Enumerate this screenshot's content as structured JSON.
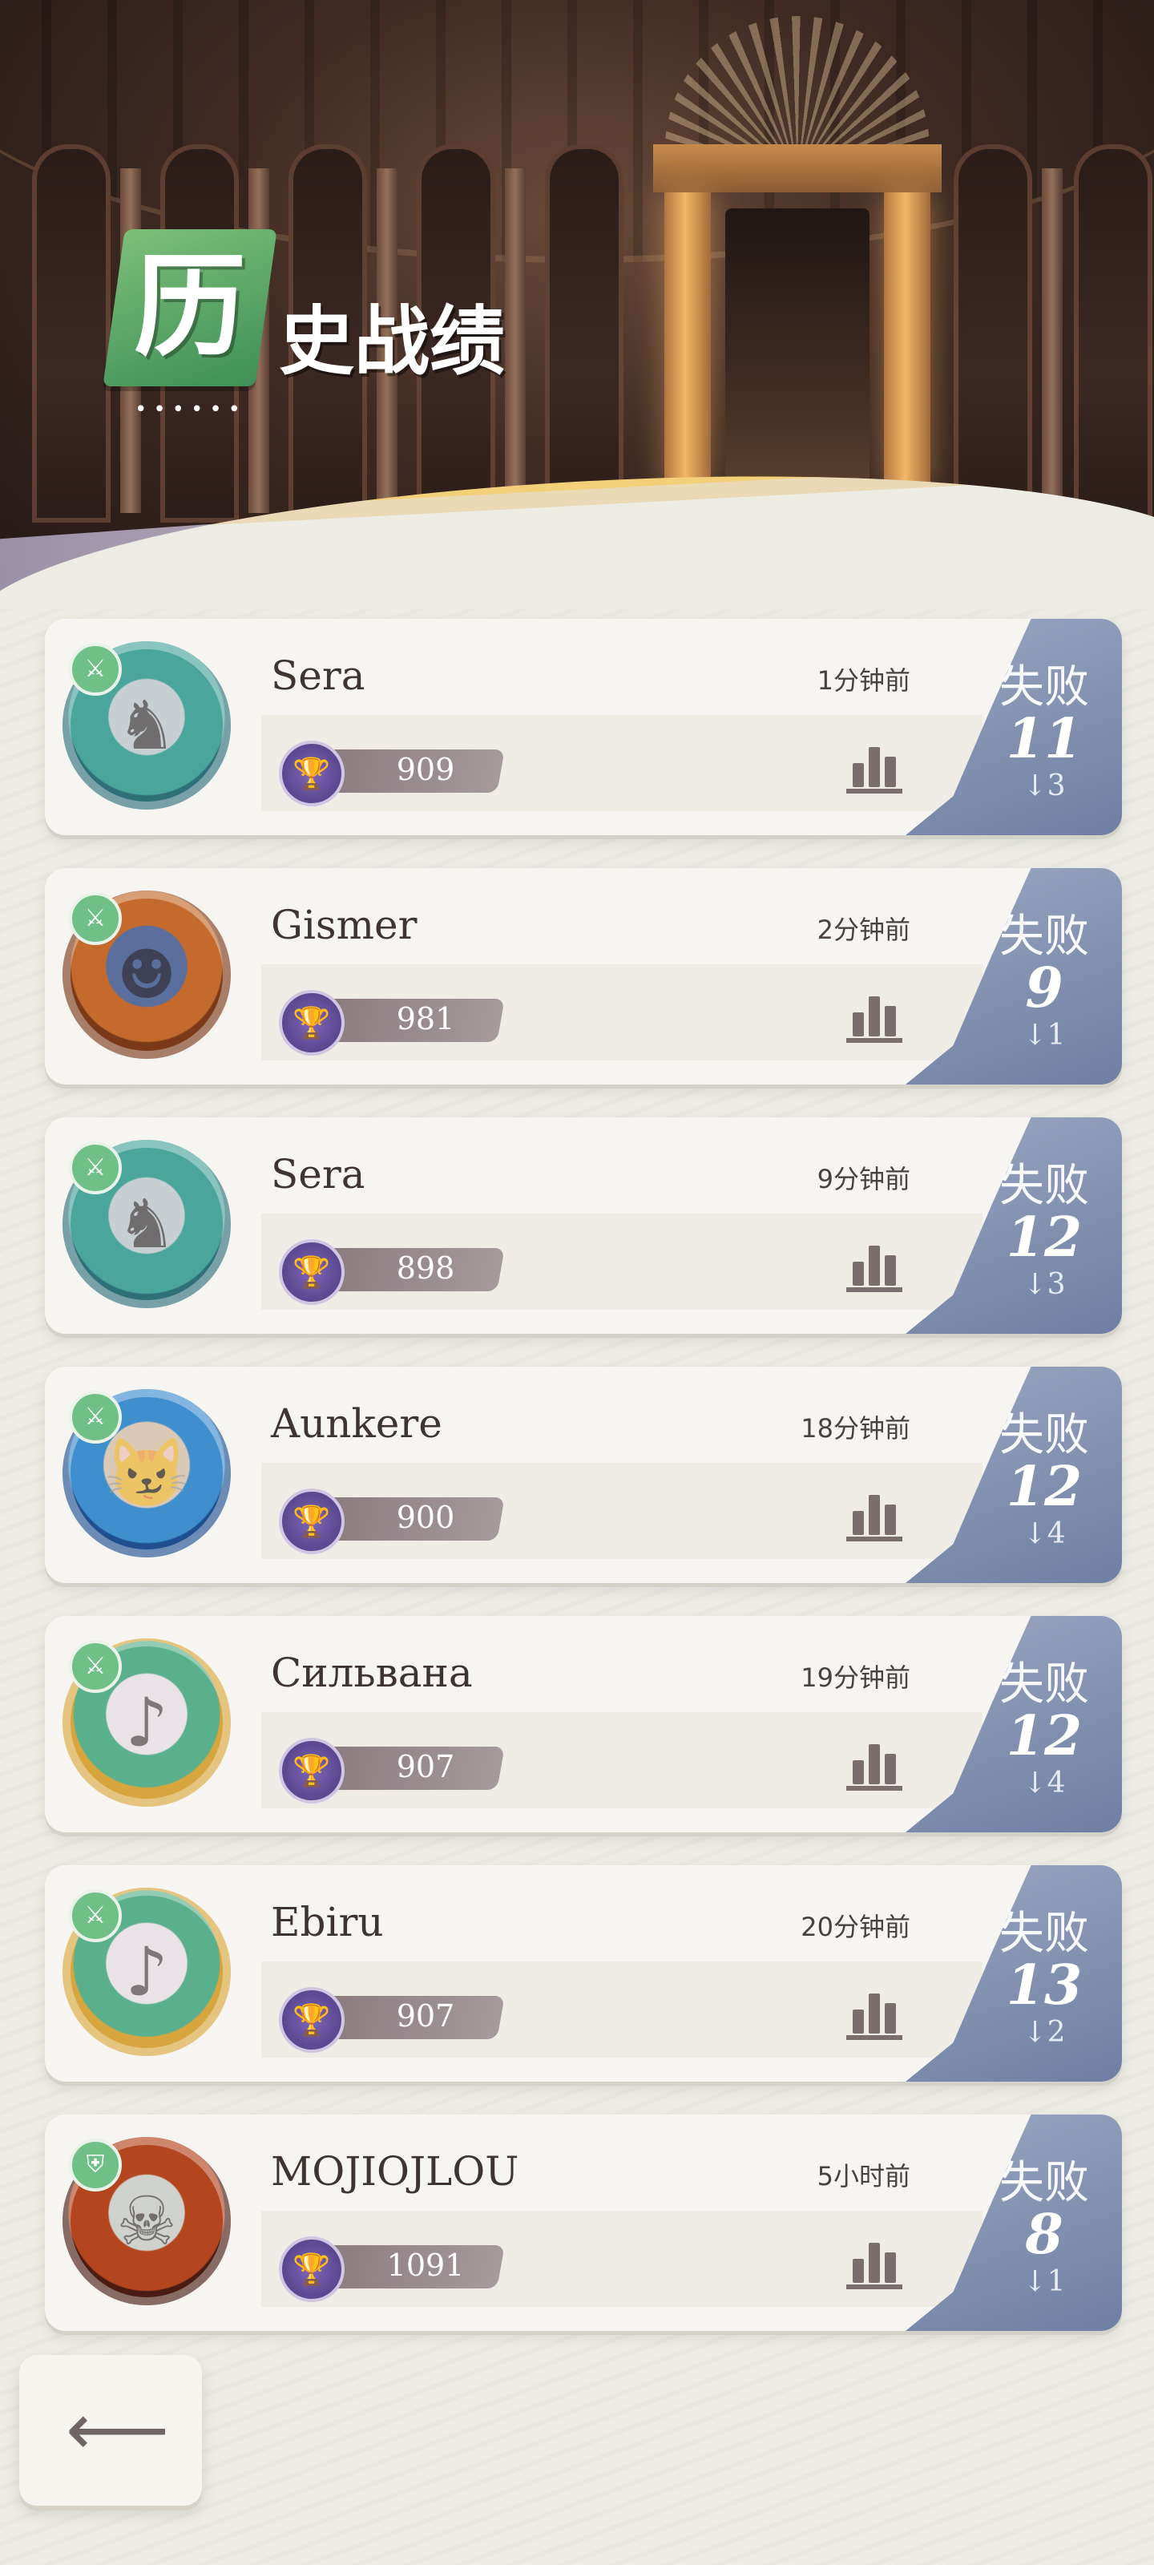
{
  "header": {
    "title_first_char": "历",
    "title_rest": "史战绩",
    "decor_dots": "••••••"
  },
  "matches": [
    {
      "name": "Sera",
      "time": "1分钟前",
      "score": "909",
      "result_label": "失败",
      "result_value": "11",
      "result_delta": "↓3",
      "avatar": "armored-bird-knight"
    },
    {
      "name": "Gismer",
      "time": "2分钟前",
      "score": "981",
      "result_label": "失败",
      "result_value": "9",
      "result_delta": "↓1",
      "avatar": "demon-warrior"
    },
    {
      "name": "Sera",
      "time": "9分钟前",
      "score": "898",
      "result_label": "失败",
      "result_value": "12",
      "result_delta": "↓3",
      "avatar": "armored-bird-knight"
    },
    {
      "name": "Aunkere",
      "time": "18分钟前",
      "score": "900",
      "result_label": "失败",
      "result_value": "12",
      "result_delta": "↓4",
      "avatar": "cat-photo"
    },
    {
      "name": "Сильвана",
      "time": "19分钟前",
      "score": "907",
      "result_label": "失败",
      "result_value": "12",
      "result_delta": "↓4",
      "avatar": "silver-haired-bard"
    },
    {
      "name": "Ebiru",
      "time": "20分钟前",
      "score": "907",
      "result_label": "失败",
      "result_value": "13",
      "result_delta": "↓2",
      "avatar": "silver-haired-bard"
    },
    {
      "name": "MOJIOJLOU",
      "time": "5小时前",
      "score": "1091",
      "result_label": "失败",
      "result_value": "8",
      "result_delta": "↓1",
      "avatar": "white-haired-warrior"
    }
  ],
  "icons": {
    "role": "sword-icon",
    "role_alt": "shield-icon",
    "trophy": "trophy-icon",
    "stats": "bar-chart-icon",
    "back": "back-arrow-icon"
  },
  "colors": {
    "result_bg": "#7f8cad",
    "title_badge": "#5aa76a",
    "score_pill": "#978a8c",
    "trophy_bg": "#5a46906"
  }
}
